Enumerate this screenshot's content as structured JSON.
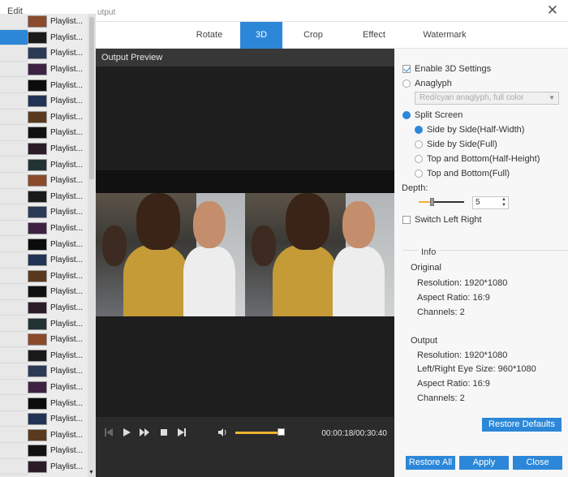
{
  "window": {
    "menu_edit": "Edit",
    "title_fragment": "utput"
  },
  "tabs": [
    {
      "label": "Rotate"
    },
    {
      "label": "3D"
    },
    {
      "label": "Crop"
    },
    {
      "label": "Effect"
    },
    {
      "label": "Watermark"
    }
  ],
  "active_tab": "3D",
  "playlist": {
    "item_label": "Playlist...",
    "items": [
      "Playlist...",
      "Playlist...",
      "Playlist...",
      "Playlist...",
      "Playlist...",
      "Playlist...",
      "Playlist...",
      "Playlist...",
      "Playlist...",
      "Playlist...",
      "Playlist...",
      "Playlist...",
      "Playlist...",
      "Playlist...",
      "Playlist...",
      "Playlist...",
      "Playlist...",
      "Playlist...",
      "Playlist...",
      "Playlist...",
      "Playlist...",
      "Playlist...",
      "Playlist...",
      "Playlist...",
      "Playlist...",
      "Playlist...",
      "Playlist...",
      "Playlist...",
      "Playlist..."
    ]
  },
  "preview": {
    "title": "Output Preview",
    "progress_fraction": 1.0,
    "volume_fraction": 0.9,
    "time": "00:00:18/00:30:40"
  },
  "settings": {
    "enable_3d_label": "Enable 3D Settings",
    "enable_3d_checked": true,
    "anaglyph_label": "Anaglyph",
    "anaglyph_select_value": "Red/cyan anaglyph, full color",
    "split_screen_label": "Split Screen",
    "split_options": [
      {
        "label": "Side by Side(Half-Width)",
        "selected": true
      },
      {
        "label": "Side by Side(Full)",
        "selected": false
      },
      {
        "label": "Top and Bottom(Half-Height)",
        "selected": false
      },
      {
        "label": "Top and Bottom(Full)",
        "selected": false
      }
    ],
    "depth_label": "Depth:",
    "depth_value": "5",
    "depth_fraction": 0.28,
    "switch_lr_label": "Switch Left Right"
  },
  "info": {
    "title": "Info",
    "original_head": "Original",
    "original": {
      "resolution": "Resolution: 1920*1080",
      "aspect": "Aspect Ratio: 16:9",
      "channels": "Channels: 2"
    },
    "output_head": "Output",
    "output": {
      "resolution": "Resolution: 1920*1080",
      "eye_size": "Left/Right Eye Size: 960*1080",
      "aspect": "Aspect Ratio: 16:9",
      "channels": "Channels: 2"
    }
  },
  "buttons": {
    "restore_defaults": "Restore Defaults",
    "restore_all": "Restore All",
    "apply": "Apply",
    "close": "Close"
  },
  "colors": {
    "accent": "#2c87d8",
    "progress": "#f2b330"
  }
}
